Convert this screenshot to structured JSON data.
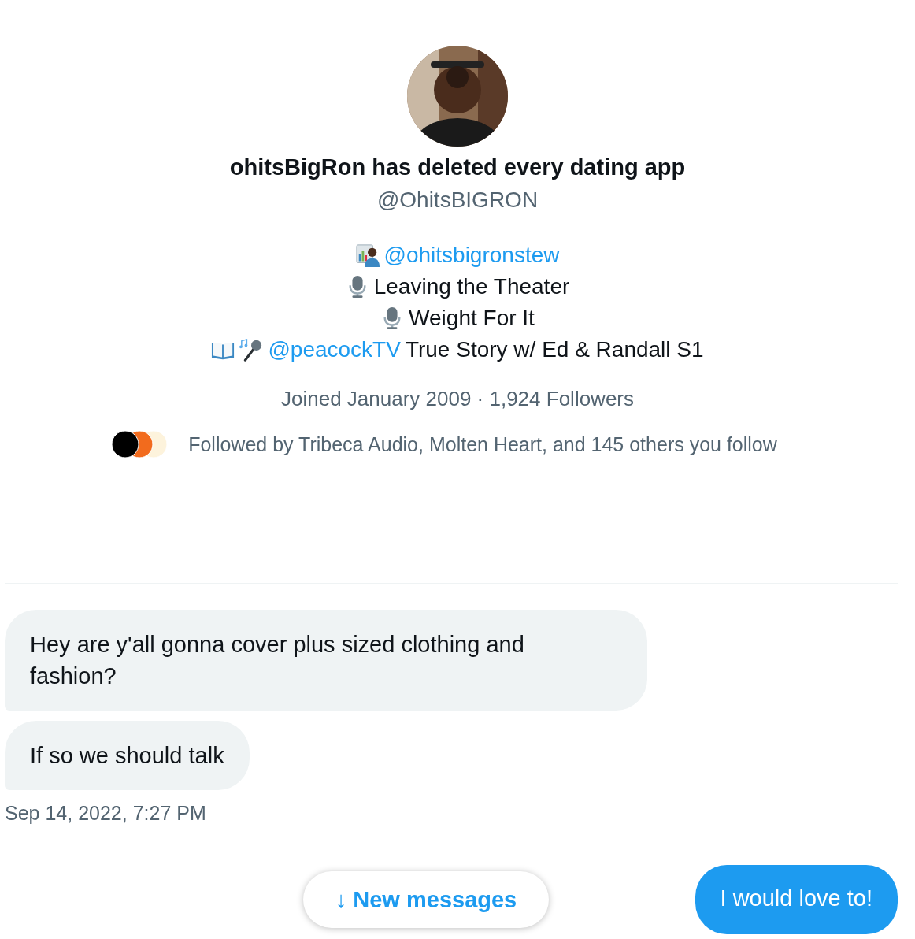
{
  "profile": {
    "avatar": {
      "kind": "picture"
    },
    "name": "ohitsBigRon has deleted every dating app",
    "handle": "@OhitsBIGRON",
    "bio": [
      [
        {
          "kind": "presenter"
        },
        {
          "kind": "link",
          "text": "@ohitsbigronstew"
        }
      ],
      [
        {
          "kind": "microphone"
        },
        {
          "kind": "text",
          "text": "Leaving the Theater"
        }
      ],
      [
        {
          "kind": "microphone"
        },
        {
          "kind": "text",
          "text": "Weight For It"
        }
      ],
      [
        {
          "kind": "book"
        },
        {
          "kind": "singing"
        },
        {
          "kind": "link",
          "text": "@peacockTV"
        },
        {
          "kind": "text",
          "text": "True Story w/ Ed & Randall S1"
        }
      ]
    ],
    "joined": "Joined January 2009 · 1,924 Followers",
    "followed_by": {
      "avatars": [
        {
          "color": "#000000"
        },
        {
          "color": "#f26b1d"
        },
        {
          "color": "#fdf3dc"
        }
      ],
      "text": "Followed by Tribeca Audio, Molten Heart, and 145 others you follow"
    }
  },
  "messages": [
    {
      "kind": "received",
      "text": "Hey are y'all gonna cover plus sized clothing and fashion?"
    },
    {
      "kind": "received",
      "text": "If so we should talk"
    }
  ],
  "timestamp": "Sep 14, 2022, 7:27 PM",
  "new_messages": {
    "icon": "↓",
    "label": "New messages"
  },
  "sent": [
    {
      "kind": "sent",
      "text": "I would love to!"
    }
  ]
}
